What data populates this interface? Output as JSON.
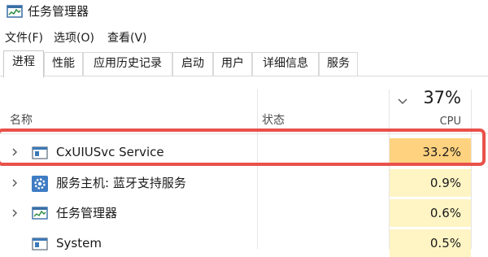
{
  "window": {
    "title": "任务管理器",
    "icon": "task-manager-icon"
  },
  "menu": {
    "items": [
      "文件(F)",
      "选项(O)",
      "查看(V)"
    ]
  },
  "tabs": {
    "items": [
      "进程",
      "性能",
      "应用历史记录",
      "启动",
      "用户",
      "详细信息",
      "服务"
    ],
    "active": "进程"
  },
  "columns": {
    "name": "名称",
    "status": "状态",
    "cpu_total": "37%",
    "cpu_label": "CPU"
  },
  "processes": [
    {
      "name": "CxUIUSvc Service",
      "status": "",
      "cpu": "33.2%",
      "icon": "service-window-icon",
      "expandable": true,
      "cpu_level": 0.332
    },
    {
      "name": "服务主机: 蓝牙支持服务",
      "status": "",
      "cpu": "0.9%",
      "icon": "gear-icon",
      "expandable": true,
      "cpu_level": 0.009
    },
    {
      "name": "任务管理器",
      "status": "",
      "cpu": "0.6%",
      "icon": "task-manager-icon",
      "expandable": true,
      "cpu_level": 0.006
    },
    {
      "name": "System",
      "status": "",
      "cpu": "0.5%",
      "icon": "system-window-icon",
      "expandable": false,
      "cpu_level": 0.005
    }
  ],
  "colors": {
    "cpu_high": "#ffd27f",
    "cpu_low": "#fff4c4",
    "highlight": "#e8514a"
  }
}
